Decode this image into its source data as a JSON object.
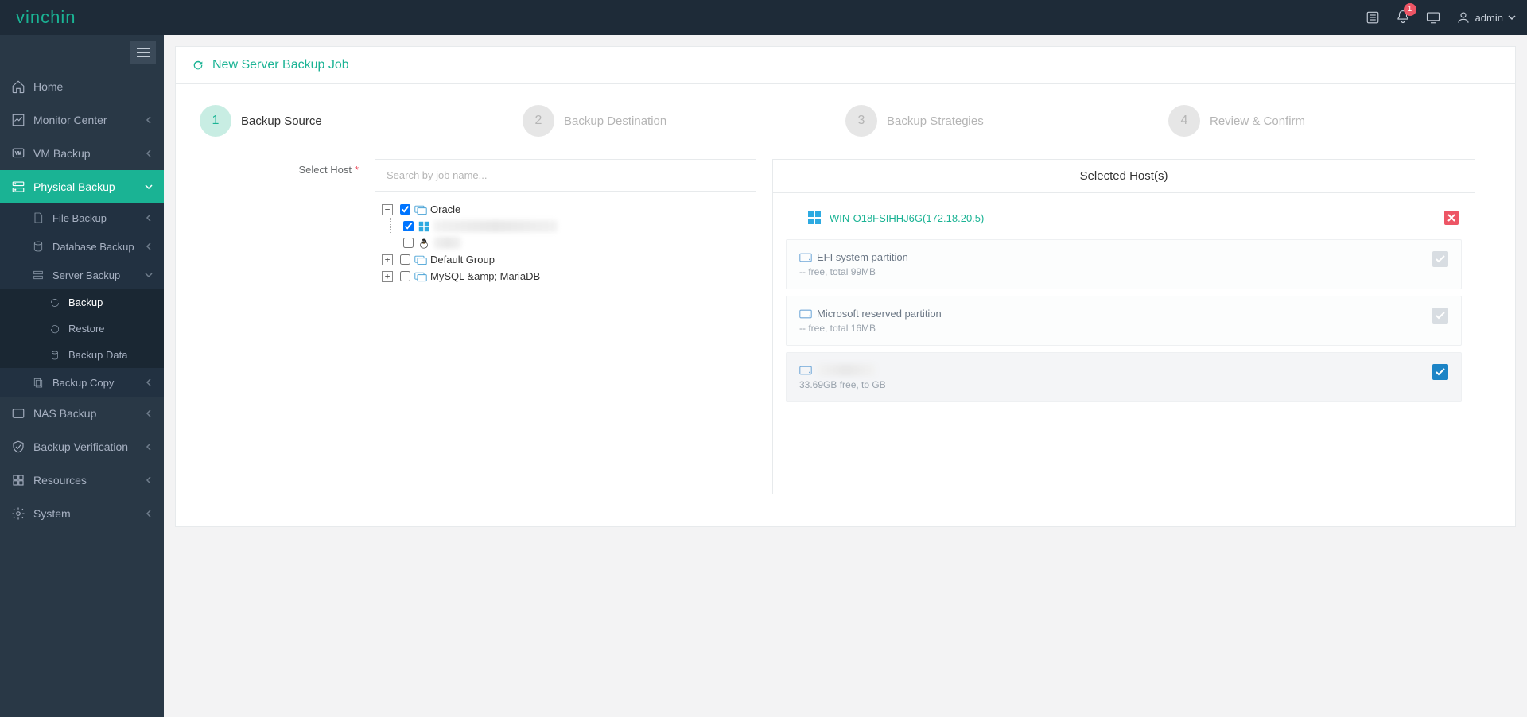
{
  "brand": "vinchin",
  "user": "admin",
  "notify_count": "1",
  "nav": {
    "home": "Home",
    "monitor": "Monitor Center",
    "vm": "VM Backup",
    "physical": "Physical Backup",
    "file": "File Backup",
    "database": "Database Backup",
    "server": "Server Backup",
    "backup": "Backup",
    "restore": "Restore",
    "backup_data": "Backup Data",
    "backup_copy": "Backup Copy",
    "nas": "NAS Backup",
    "verify": "Backup Verification",
    "resources": "Resources",
    "system": "System"
  },
  "page_title": "New Server Backup Job",
  "steps": {
    "s1": {
      "n": "1",
      "l": "Backup Source"
    },
    "s2": {
      "n": "2",
      "l": "Backup Destination"
    },
    "s3": {
      "n": "3",
      "l": "Backup Strategies"
    },
    "s4": {
      "n": "4",
      "l": "Review & Confirm"
    }
  },
  "select_host_label": "Select Host",
  "search_placeholder": "Search by job name...",
  "tree": {
    "oracle": "Oracle",
    "host1_hidden": "WIN-O18FSIHHJ6G(172…",
    "host2_hidden": "Ora…",
    "default_group": "Default Group",
    "mysql_mariadb": "MySQL &amp; MariaDB"
  },
  "selected_heading": "Selected Host(s)",
  "selected_host": "WIN-O18FSIHHJ6G(172.18.20.5)",
  "parts": {
    "p1_name": "EFI system partition",
    "p1_meta": "-- free, total 99MB",
    "p2_name": "Microsoft reserved partition",
    "p2_meta": "-- free, total 16MB",
    "p3_name_hidden": "████████",
    "p3_meta": "33.69GB free, to        GB"
  }
}
